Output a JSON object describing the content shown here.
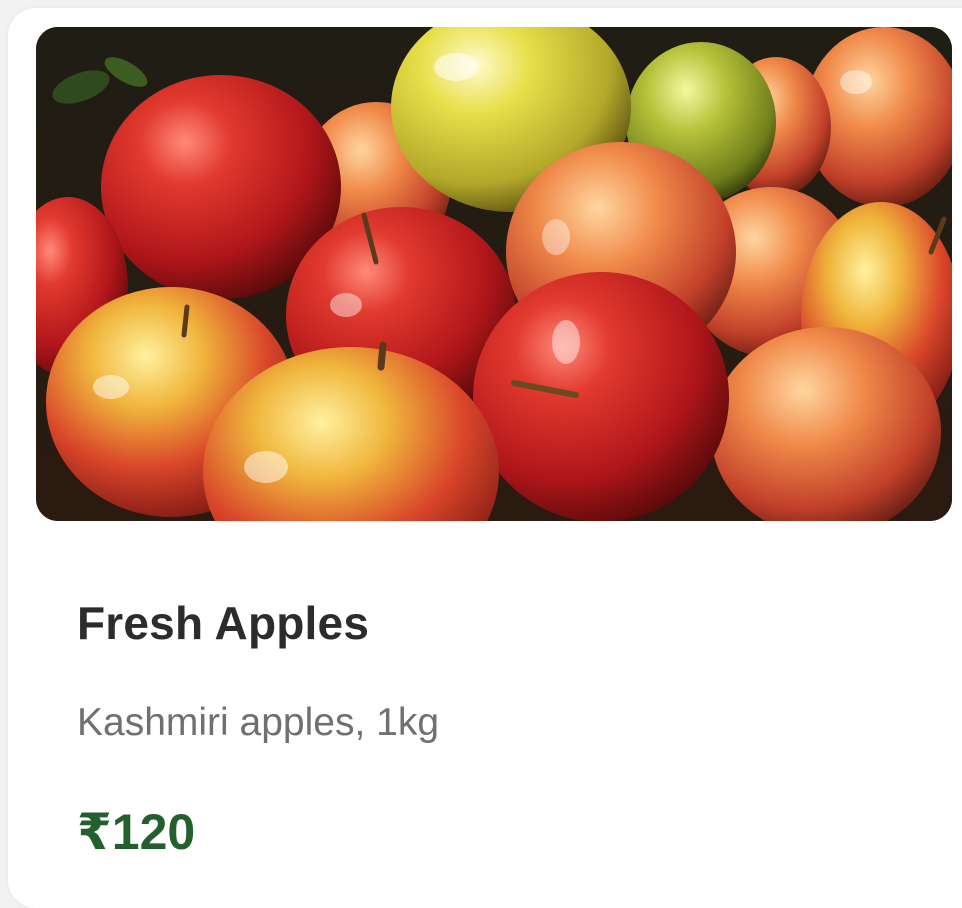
{
  "product": {
    "name": "Fresh Apples",
    "description": "Kashmiri apples, 1kg",
    "price": "₹120"
  },
  "colors": {
    "price": "#24602e",
    "title": "#2c2c2c",
    "description": "#707070",
    "card_background": "#ffffff"
  },
  "image": {
    "subject": "apples"
  }
}
